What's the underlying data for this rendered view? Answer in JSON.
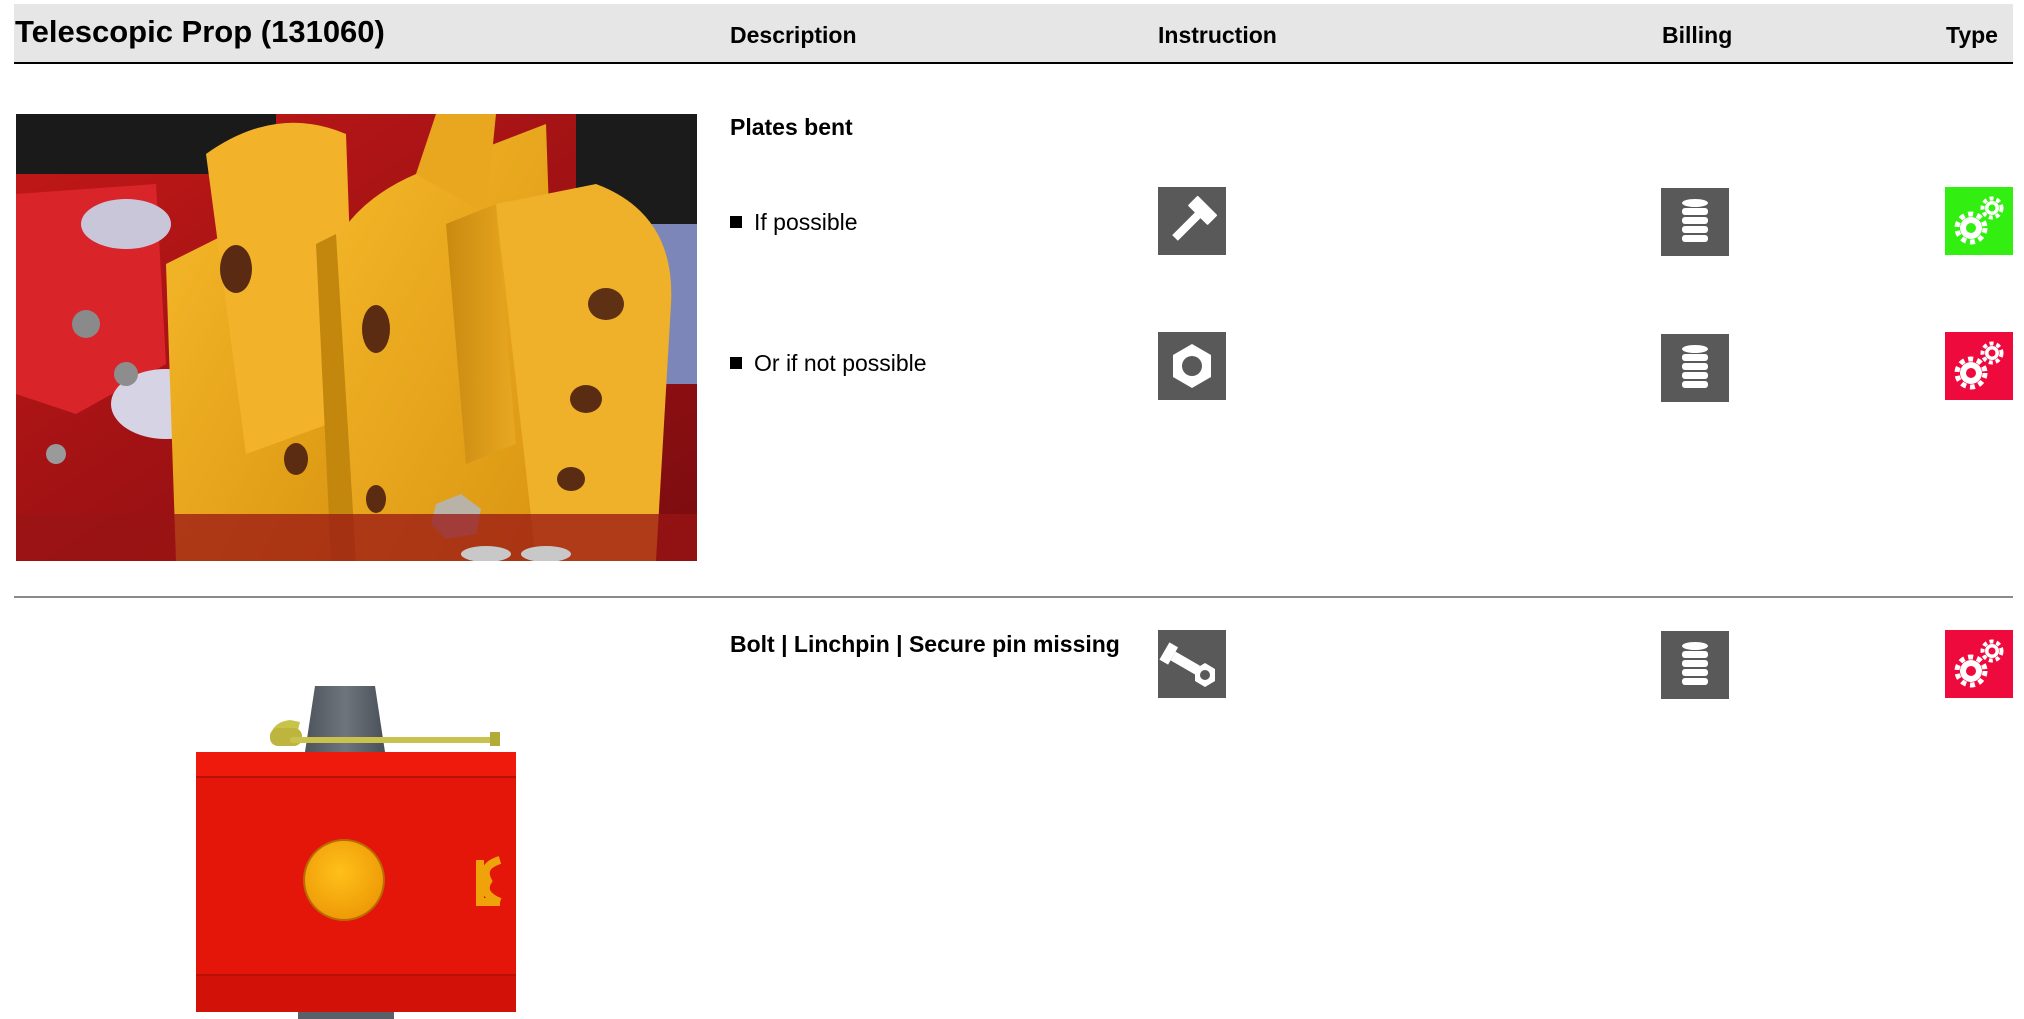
{
  "header": {
    "title": "Telescopic Prop (131060)",
    "col_description": "Description",
    "col_instruction": "Instruction",
    "col_billing": "Billing",
    "col_type": "Type"
  },
  "sections": [
    {
      "title": "Plates bent",
      "rows": [
        {
          "label": "If possible",
          "instruction_icon": "hammer-icon",
          "billing_icon": "coin-stack-icon",
          "type_icon": "gears-icon",
          "type_color": "#33ee11"
        },
        {
          "label": "Or if not possible",
          "instruction_icon": "nut-icon",
          "billing_icon": "coin-stack-icon",
          "type_icon": "gears-icon",
          "type_color": "#ee0a3c"
        }
      ]
    },
    {
      "title": "Bolt | Linchpin | Secure pin missing",
      "instruction_icon": "bolt-and-nut-icon",
      "billing_icon": "coin-stack-icon",
      "type_icon": "gears-icon",
      "type_color": "#ee0a3c"
    }
  ],
  "colors": {
    "header_bg": "#e6e6e6",
    "icon_dark": "#595959",
    "type_green": "#33ee11",
    "type_red": "#ee0a3c"
  }
}
